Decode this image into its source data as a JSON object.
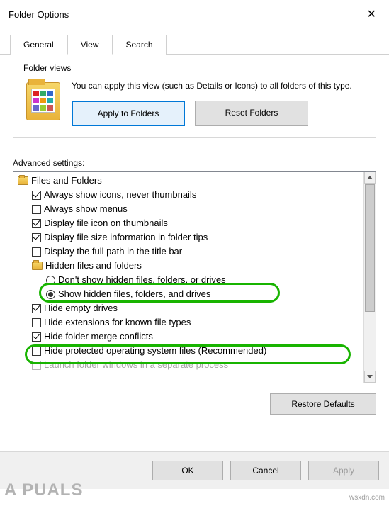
{
  "window": {
    "title": "Folder Options"
  },
  "tabs": {
    "general": "General",
    "view": "View",
    "search": "Search"
  },
  "folder_views": {
    "title": "Folder views",
    "text": "You can apply this view (such as Details or Icons) to all folders of this type.",
    "apply": "Apply to Folders",
    "reset": "Reset Folders"
  },
  "advanced": {
    "label": "Advanced settings:",
    "root": "Files and Folders",
    "items": [
      {
        "label": "Always show icons, never thumbnails",
        "checked": true
      },
      {
        "label": "Always show menus",
        "checked": false
      },
      {
        "label": "Display file icon on thumbnails",
        "checked": true
      },
      {
        "label": "Display file size information in folder tips",
        "checked": true
      },
      {
        "label": "Display the full path in the title bar",
        "checked": false
      }
    ],
    "hidden_group": "Hidden files and folders",
    "hidden_options": [
      {
        "label": "Don't show hidden files, folders, or drives",
        "on": false
      },
      {
        "label": "Show hidden files, folders, and drives",
        "on": true
      }
    ],
    "items2": [
      {
        "label": "Hide empty drives",
        "checked": true
      },
      {
        "label": "Hide extensions for known file types",
        "checked": false
      },
      {
        "label": "Hide folder merge conflicts",
        "checked": true
      },
      {
        "label": "Hide protected operating system files (Recommended)",
        "checked": false
      },
      {
        "label": "Launch folder windows in a separate process",
        "checked": false
      }
    ]
  },
  "buttons": {
    "restore": "Restore Defaults",
    "ok": "OK",
    "cancel": "Cancel",
    "apply": "Apply"
  },
  "watermark": {
    "text": "A  PUALS",
    "site": "wsxdn.com"
  }
}
